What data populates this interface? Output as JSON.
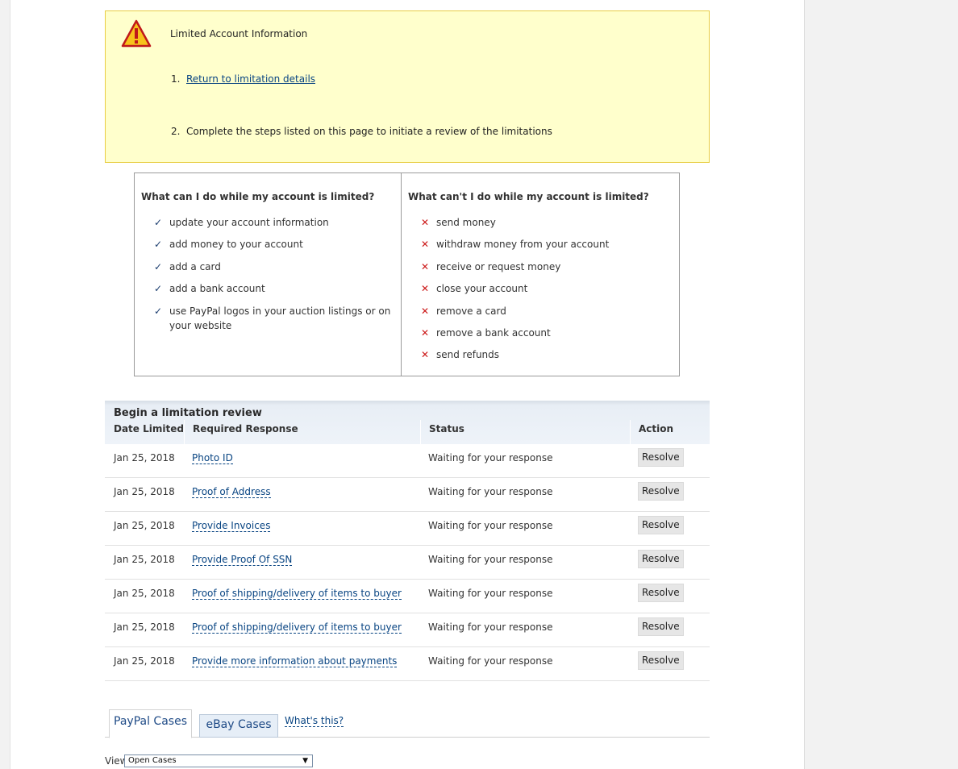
{
  "alert": {
    "title": "Limited Account Information",
    "steps": [
      {
        "num": "1.",
        "text": "Return to limitation details"
      },
      {
        "num": "2.",
        "text": "Complete the steps listed on this page to initiate a review of the limitations"
      }
    ]
  },
  "can_do": {
    "heading": "What can I do while my account is limited?",
    "items": [
      "update your account information",
      "add money to your account",
      "add a card",
      "add a bank account",
      "use PayPal logos in your auction listings or on your website"
    ]
  },
  "cannot_do": {
    "heading": "What can't I do while my account is limited?",
    "items": [
      "send money",
      "withdraw money from your account",
      "receive or request money",
      "close your account",
      "remove a card",
      "remove a bank account",
      "send refunds"
    ]
  },
  "review": {
    "title": "Begin a limitation review",
    "columns": [
      "Date Limited",
      "Required Response",
      "Status",
      "Action"
    ],
    "rows": [
      {
        "date": "Jan 25, 2018",
        "response": "Photo ID",
        "status": "Waiting for your response",
        "action": "Resolve"
      },
      {
        "date": "Jan 25, 2018",
        "response": "Proof of Address",
        "status": "Waiting for your response",
        "action": "Resolve"
      },
      {
        "date": "Jan 25, 2018",
        "response": "Provide Invoices",
        "status": "Waiting for your response",
        "action": "Resolve"
      },
      {
        "date": "Jan 25, 2018",
        "response": "Provide Proof Of SSN",
        "status": "Waiting for your response",
        "action": "Resolve"
      },
      {
        "date": "Jan 25, 2018",
        "response": "Proof of shipping/delivery of items to buyer",
        "status": "Waiting for your response",
        "action": "Resolve"
      },
      {
        "date": "Jan 25, 2018",
        "response": "Proof of shipping/delivery of items to buyer",
        "status": "Waiting for your response",
        "action": "Resolve"
      },
      {
        "date": "Jan 25, 2018",
        "response": "Provide more information about payments",
        "status": "Waiting for your response",
        "action": "Resolve"
      }
    ]
  },
  "tabs": {
    "paypal": "PayPal Cases",
    "ebay": "eBay Cases",
    "whats_this": "What's this?"
  },
  "view": {
    "label": "View:",
    "selected": "Open Cases"
  },
  "colors": {
    "alert_bg": "#ffffcc",
    "link": "#084482",
    "check": "#1a3c6e",
    "cross": "#cc1a1a"
  }
}
